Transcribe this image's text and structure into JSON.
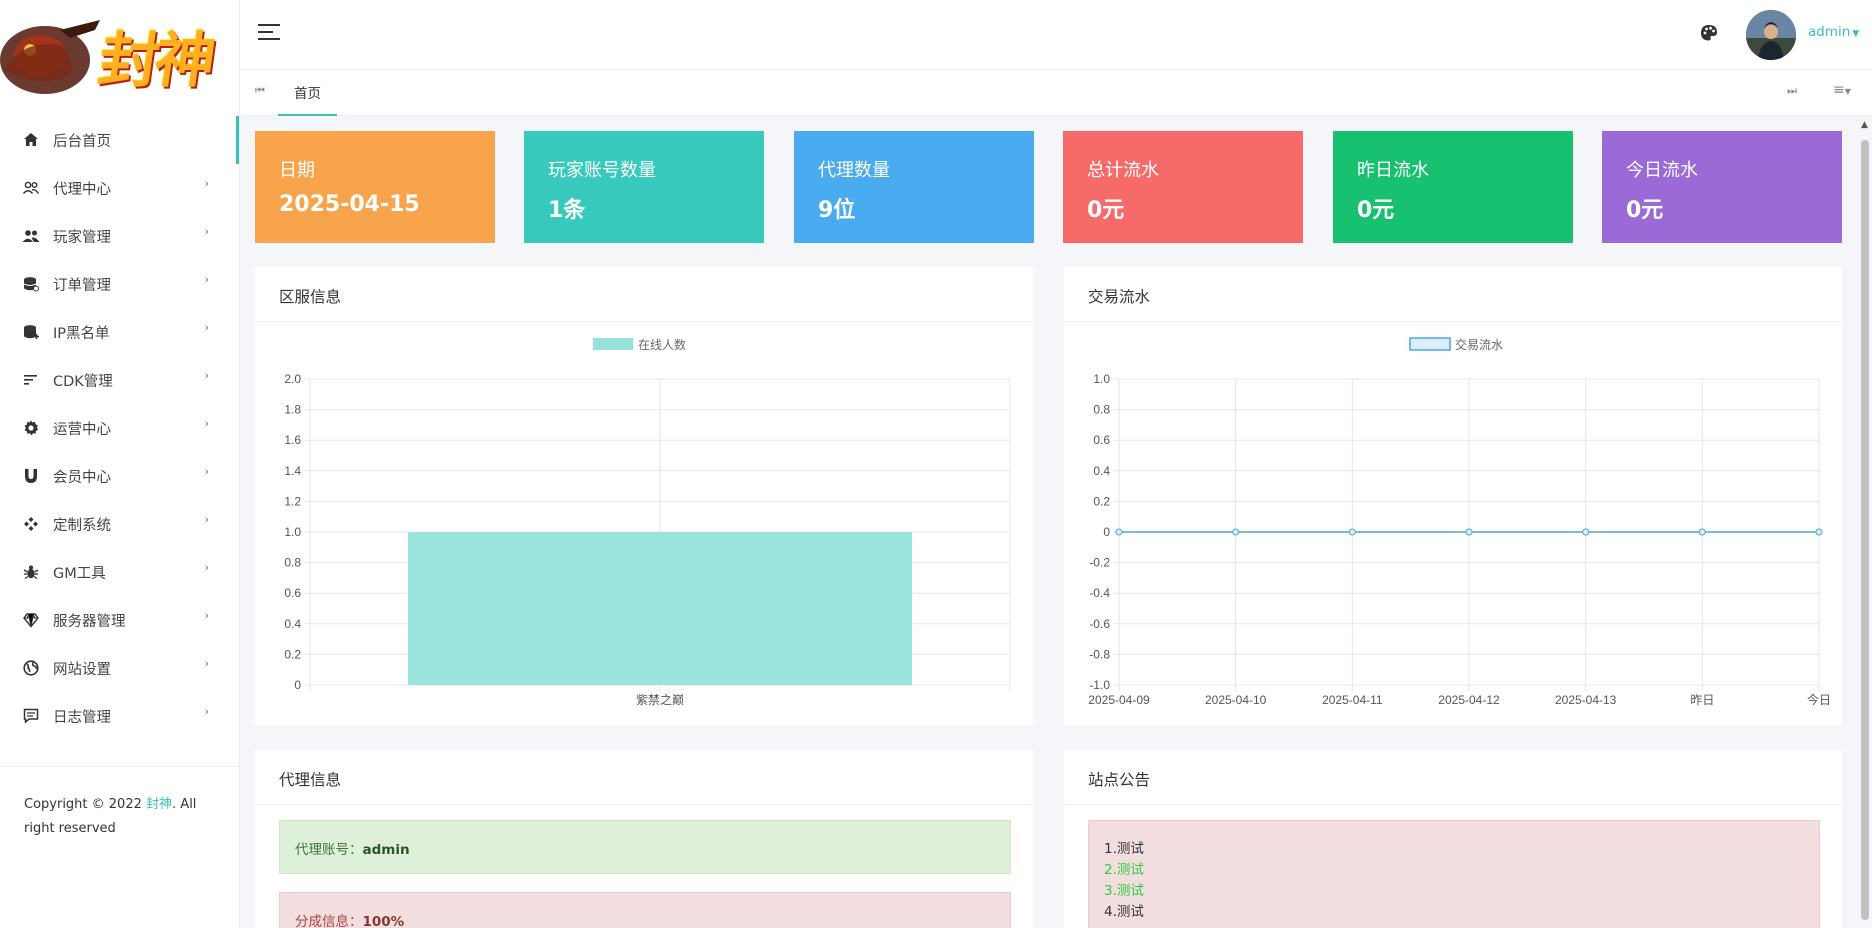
{
  "sidebar": {
    "logo_text": "封神",
    "items": [
      {
        "label": "后台首页",
        "icon": "home-icon",
        "active": true
      },
      {
        "label": "代理中心",
        "icon": "users-icon"
      },
      {
        "label": "玩家管理",
        "icon": "user-group-icon"
      },
      {
        "label": "订单管理",
        "icon": "database-icon"
      },
      {
        "label": "IP黑名单",
        "icon": "database-plus-icon"
      },
      {
        "label": "CDK管理",
        "icon": "list-icon"
      },
      {
        "label": "运营中心",
        "icon": "gear-icon"
      },
      {
        "label": "会员中心",
        "icon": "magnet-icon"
      },
      {
        "label": "定制系统",
        "icon": "diamond-grid-icon"
      },
      {
        "label": "GM工具",
        "icon": "bug-icon"
      },
      {
        "label": "服务器管理",
        "icon": "gem-icon"
      },
      {
        "label": "网站设置",
        "icon": "globe-icon"
      },
      {
        "label": "日志管理",
        "icon": "comment-icon"
      }
    ],
    "footer": {
      "prefix": "Copyright © 2022 ",
      "brand": "封神",
      "suffix": ". All right reserved"
    }
  },
  "header": {
    "username": "admin"
  },
  "tabs": [
    {
      "label": "首页"
    }
  ],
  "stats": [
    {
      "label": "日期",
      "value": "2025-04-15",
      "color": "#f8a44c"
    },
    {
      "label": "玩家账号数量",
      "value": "1条",
      "color": "#36c9bc"
    },
    {
      "label": "代理数量",
      "value": "9位",
      "color": "#4aacf0"
    },
    {
      "label": "总计流水",
      "value": "0元",
      "color": "#f76a6a"
    },
    {
      "label": "昨日流水",
      "value": "0元",
      "color": "#17c16f"
    },
    {
      "label": "今日流水",
      "value": "0元",
      "color": "#9b6ad6"
    }
  ],
  "panels": {
    "server": {
      "title": "区服信息"
    },
    "trade": {
      "title": "交易流水"
    },
    "agent": {
      "title": "代理信息",
      "account_label": "代理账号：",
      "account_value": "admin",
      "share_label": "分成信息：",
      "share_value": "100%"
    },
    "notice": {
      "title": "站点公告",
      "lines": [
        {
          "text": "1.测试",
          "color": "#333333"
        },
        {
          "text": "2.测试",
          "color": "#2ecc40"
        },
        {
          "text": "3.测试",
          "color": "#2ecc40"
        },
        {
          "text": "4.测试",
          "color": "#333333"
        }
      ]
    }
  },
  "chart_data": [
    {
      "type": "bar",
      "legend": [
        "在线人数"
      ],
      "categories": [
        "紫禁之巅"
      ],
      "series": [
        {
          "name": "在线人数",
          "values": [
            1
          ]
        }
      ],
      "ylim": [
        0,
        2.0
      ],
      "yticks": [
        "2.0",
        "1.8",
        "1.6",
        "1.4",
        "1.2",
        "1.0",
        "0.8",
        "0.6",
        "0.4",
        "0.2",
        "0"
      ],
      "color": "#96e2da",
      "grid": true,
      "legend_position": "top"
    },
    {
      "type": "line",
      "legend": [
        "交易流水"
      ],
      "categories": [
        "2025-04-09",
        "2025-04-10",
        "2025-04-11",
        "2025-04-12",
        "2025-04-13",
        "昨日",
        "今日"
      ],
      "series": [
        {
          "name": "交易流水",
          "values": [
            0,
            0,
            0,
            0,
            0,
            0,
            0
          ]
        }
      ],
      "ylim": [
        -1.0,
        1.0
      ],
      "yticks": [
        "1.0",
        "0.8",
        "0.6",
        "0.4",
        "0.2",
        "0",
        "-0.2",
        "-0.4",
        "-0.6",
        "-0.8",
        "-1.0"
      ],
      "color": "#4aa6e0",
      "grid": true,
      "legend_position": "top"
    }
  ]
}
